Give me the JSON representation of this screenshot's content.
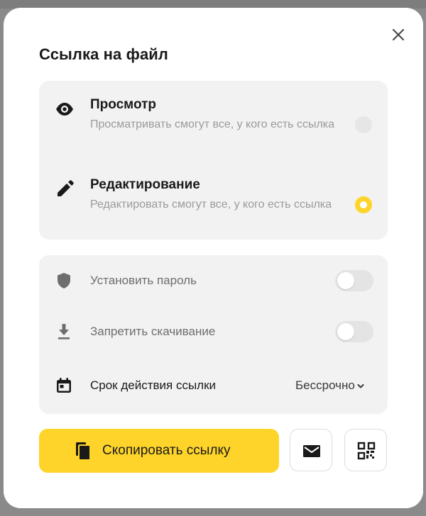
{
  "dialog": {
    "title": "Ссылка на файл",
    "close_icon": "close-icon"
  },
  "access": {
    "options": [
      {
        "icon": "eye-icon",
        "title": "Просмотр",
        "description": "Просматривать смогут все, у кого есть ссылка",
        "selected": false
      },
      {
        "icon": "pencil-icon",
        "title": "Редактирование",
        "description": "Редактировать смогут все, у кого есть ссылка",
        "selected": true
      }
    ]
  },
  "settings": {
    "password": {
      "icon": "shield-icon",
      "label": "Установить пароль",
      "enabled": false
    },
    "no_download": {
      "icon": "download-icon",
      "label": "Запретить скачивание",
      "enabled": false
    },
    "expiry": {
      "icon": "calendar-icon",
      "label": "Срок действия ссылки",
      "value": "Бессрочно"
    }
  },
  "actions": {
    "copy_label": "Скопировать ссылку",
    "copy_icon": "copy-icon",
    "mail_icon": "mail-icon",
    "qr_icon": "qr-code-icon"
  },
  "colors": {
    "accent": "#fed42b",
    "card_bg": "#f2f2f2",
    "text_primary": "#1a1a1a",
    "text_secondary": "#9a9a9a"
  }
}
